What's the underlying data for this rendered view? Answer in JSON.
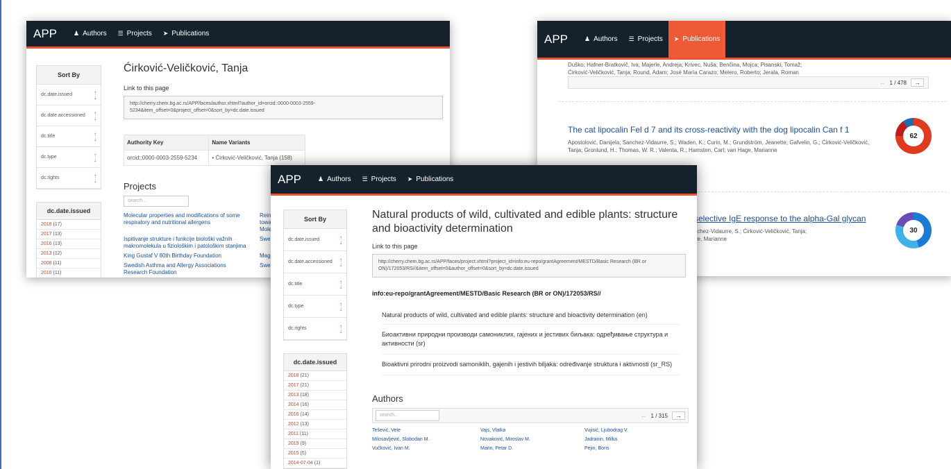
{
  "nav": {
    "brand": "APP",
    "authors": "Authors",
    "projects": "Projects",
    "publications": "Publications"
  },
  "sort": {
    "header": "Sort By",
    "options": [
      "dc.date.issued",
      "dc.date.accessioned",
      "dc.title",
      "dc.type",
      "dc.rights"
    ]
  },
  "w1": {
    "title": "Ćirković-Veličković, Tanja",
    "link_label": "Link to this page",
    "url": "http://cherry.chem.bg.ac.rs/APP/faces/author.xhtml?author_id=orcid::0000-0003-2559-5234&item_offset=0&project_offset=0&sort_by=dc.date.issued",
    "authority_header": "Authority Key",
    "variants_header": "Name Variants",
    "authority_key": "orcid::0000-0003-2559-5234",
    "variant": "Ćirković-Veličković, Tanja (158)",
    "facet_header": "dc.date.issued",
    "facets": [
      {
        "label": "2018",
        "count": "(17)"
      },
      {
        "label": "2017",
        "count": "(13)"
      },
      {
        "label": "2016",
        "count": "(13)"
      },
      {
        "label": "2013",
        "count": "(12)"
      },
      {
        "label": "2008",
        "count": "(11)"
      },
      {
        "label": "2010",
        "count": "(11)"
      }
    ],
    "projects_title": "Projects",
    "search_placeholder": "search...",
    "projects": [
      {
        "name": "Molecular properties and modifications of some respiratory and nutritional allergens",
        "side": "Rein towa Mole"
      },
      {
        "name": "Ispitivanje strukture i funkcije biološki važnih makromolekula u fiziološkim i patološkim stanjima",
        "side": "Swe"
      },
      {
        "name": "King Gustaf V 80th Birthday Foundation",
        "side": "Mag"
      },
      {
        "name": "Swedish Asthma and Allergy Associations Research Foundation",
        "side": "Swe"
      }
    ]
  },
  "w2": {
    "authors_line1": "Duško; Hafner-Bratkovič, Iva; Majerle, Andreja; Krivec, Nuša; Benčina, Mojca; Pisanski, Tomaž;",
    "authors_line2": "Ćirković-Veličković, Tanja; Round, Adam; José María Carazo; Melero, Roberto; Jerala, Roman",
    "pager": "1 / 478",
    "pub1": {
      "title": "The cat lipocalin Fel d 7 and its cross-reactivity with the dog lipocalin Can f 1",
      "authors": "Apostolović, Danijela; Sanchez-Vidaurre, S.; Waden, K.; Curin, M.; Grundström, Jeanette; Gafvelin, G.; Ćirković-Veličković, Tanja; Gronlund, H.; Thomas, W. R.; Valenta, R.; Hamsten, Carl; van Hage, Marianne",
      "score": "62"
    },
    "pub2": {
      "title": "a selective IgE response to the alpha-Gal glycan",
      "authors_line1": "Sanchez-Vidaurre, S.; Ćirković-Veličković, Tanja;",
      "authors_line2": "Hage, Marianne",
      "score": "30"
    }
  },
  "w3": {
    "title": "Natural products of wild, cultivated and edible plants: structure and bioactivity determination",
    "link_label": "Link to this page",
    "url": "http://cherry.chem.bg.ac.rs/APP/faces/project.xhtml?project_id=info:eu-repo/grantAgreement/MESTD/Basic Research (BR or ON)/172053/RS//&item_offset=0&author_offset=0&sort_by=dc.date.issued",
    "grant": "info:eu-repo/grantAgreement/MESTD/Basic Research (BR or ON)/172053/RS//",
    "titles": [
      "Natural products of wild, cultivated and edible plants: structure and bioactivity determination (en)",
      "Биоактивни природни производи самониклих, гајених и јестивих биљака: одређивање структура и активности (sr)",
      "Bioaktivni prirodni proizvodi samoniklih, gajenih i jestivih biljaka: određivanje struktura i aktivnosti (sr_RS)"
    ],
    "facet_header": "dc.date.issued",
    "facets": [
      {
        "label": "2018",
        "count": "(21)"
      },
      {
        "label": "2017",
        "count": "(21)"
      },
      {
        "label": "2013",
        "count": "(18)"
      },
      {
        "label": "2014",
        "count": "(16)"
      },
      {
        "label": "2016",
        "count": "(14)"
      },
      {
        "label": "2012",
        "count": "(13)"
      },
      {
        "label": "2011",
        "count": "(11)"
      },
      {
        "label": "2019",
        "count": "(9)"
      },
      {
        "label": "2015",
        "count": "(5)"
      },
      {
        "label": "2014-07-04",
        "count": "(1)"
      }
    ],
    "authors_title": "Authors",
    "search_placeholder": "search...",
    "pager": "1 / 315",
    "authors": [
      [
        "Tešević, Vele",
        "Vajs, Vlatka",
        "Vujisić, Ljubodrag V."
      ],
      [
        "Milosavljević, Slobodan M.",
        "Novaković, Miroslav M.",
        "Jadranin, Milka"
      ],
      [
        "Vučković, Ivan M.",
        "Marin, Petar D.",
        "Pejin, Boris"
      ]
    ]
  }
}
